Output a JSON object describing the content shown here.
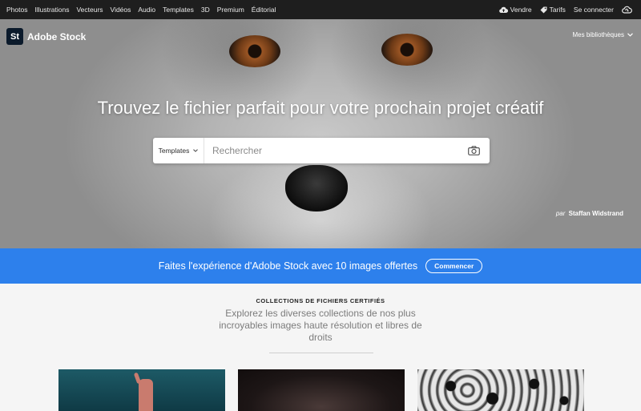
{
  "topnav": {
    "links": [
      "Photos",
      "Illustrations",
      "Vecteurs",
      "Vidéos",
      "Audio",
      "Templates",
      "3D",
      "Premium",
      "Éditorial"
    ],
    "sell_label": "Vendre",
    "pricing_label": "Tarifs",
    "signin_label": "Se connecter",
    "icons": {
      "sell": "cloud-upload-icon",
      "pricing": "tag-icon",
      "cc": "creative-cloud-icon"
    }
  },
  "brand": {
    "badge": "St",
    "name": "Adobe Stock"
  },
  "libraries_label": "Mes bibliothèques",
  "hero": {
    "headline": "Trouvez le fichier parfait pour votre prochain projet créatif",
    "search": {
      "category": "Templates",
      "placeholder": "Rechercher"
    },
    "credit_prefix": "par",
    "credit_name": "Staffan Widstrand"
  },
  "promo": {
    "text": "Faites l'expérience d'Adobe Stock avec 10 images offertes",
    "button": "Commencer",
    "color": "#2d80ec"
  },
  "collections": {
    "title": "COLLECTIONS DE FICHIERS CERTIFIÉS",
    "description": "Explorez les diverses collections de nos plus incroyables images haute résolution et libres de droits"
  }
}
